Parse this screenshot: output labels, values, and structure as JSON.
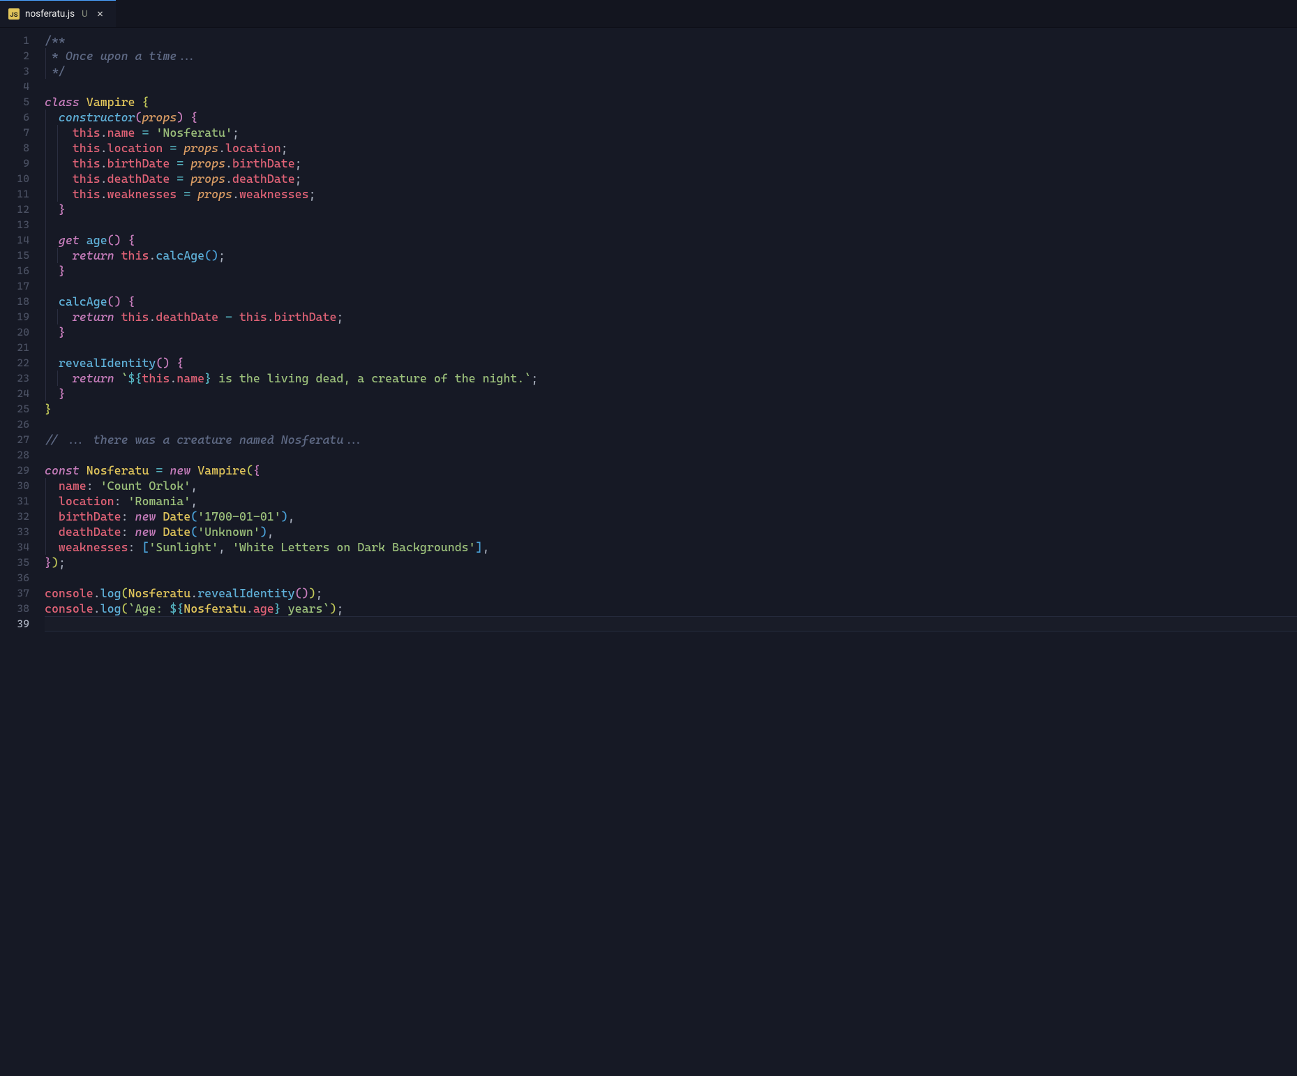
{
  "tab": {
    "filename": "nosferatu.js",
    "modified_marker": "U",
    "language_badge": "JS",
    "close_glyph": "×"
  },
  "editor": {
    "line_count": 39,
    "current_line": 39
  },
  "code": {
    "l1": "/**",
    "l2a": " * ",
    "l2b": "Once upon a time...",
    "l3": " */",
    "l5_class": "class",
    "l5_Vampire": "Vampire",
    "l6_constructor": "constructor",
    "l6_props": "props",
    "l7_this": "this",
    "l7_name": "name",
    "l7_str": "'Nosferatu'",
    "l8_this": "this",
    "l8_loc": "location",
    "l8_props": "props",
    "l8_loc2": "location",
    "l9_this": "this",
    "l9_bd": "birthDate",
    "l9_props": "props",
    "l9_bd2": "birthDate",
    "l10_this": "this",
    "l10_dd": "deathDate",
    "l10_props": "props",
    "l10_dd2": "deathDate",
    "l11_this": "this",
    "l11_wk": "weaknesses",
    "l11_props": "props",
    "l11_wk2": "weaknesses",
    "l14_get": "get",
    "l14_age": "age",
    "l15_return": "return",
    "l15_this": "this",
    "l15_calc": "calcAge",
    "l18_calc": "calcAge",
    "l19_return": "return",
    "l19_this1": "this",
    "l19_dd": "deathDate",
    "l19_this2": "this",
    "l19_bd": "birthDate",
    "l22_reveal": "revealIdentity",
    "l23_return": "return",
    "l23_this": "this",
    "l23_name": "name",
    "l23_s1": "`",
    "l23_s2": "${",
    "l23_s3": "}",
    "l23_s4": " is the living dead, a creature of the night.",
    "l23_s5": "`",
    "l27": "// ... there was a creature named Nosferatu...",
    "l29_const": "const",
    "l29_Nosf": "Nosferatu",
    "l29_new": "new",
    "l29_Vampire": "Vampire",
    "l30_k": "name",
    "l30_v": "'Count Orlok'",
    "l31_k": "location",
    "l31_v": "'Romania'",
    "l32_k": "birthDate",
    "l32_new": "new",
    "l32_Date": "Date",
    "l32_v": "'1700-01-01'",
    "l33_k": "deathDate",
    "l33_new": "new",
    "l33_Date": "Date",
    "l33_v": "'Unknown'",
    "l34_k": "weaknesses",
    "l34_v1": "'Sunlight'",
    "l34_v2": "'White Letters on Dark Backgrounds'",
    "l37_console": "console",
    "l37_log": "log",
    "l37_Nosf": "Nosferatu",
    "l37_reveal": "revealIdentity",
    "l38_console": "console",
    "l38_log": "log",
    "l38_s1": "`Age: ",
    "l38_s2": "${",
    "l38_Nosf": "Nosferatu",
    "l38_age": "age",
    "l38_s3": "}",
    "l38_s4": " years",
    "l38_s5": "`"
  }
}
